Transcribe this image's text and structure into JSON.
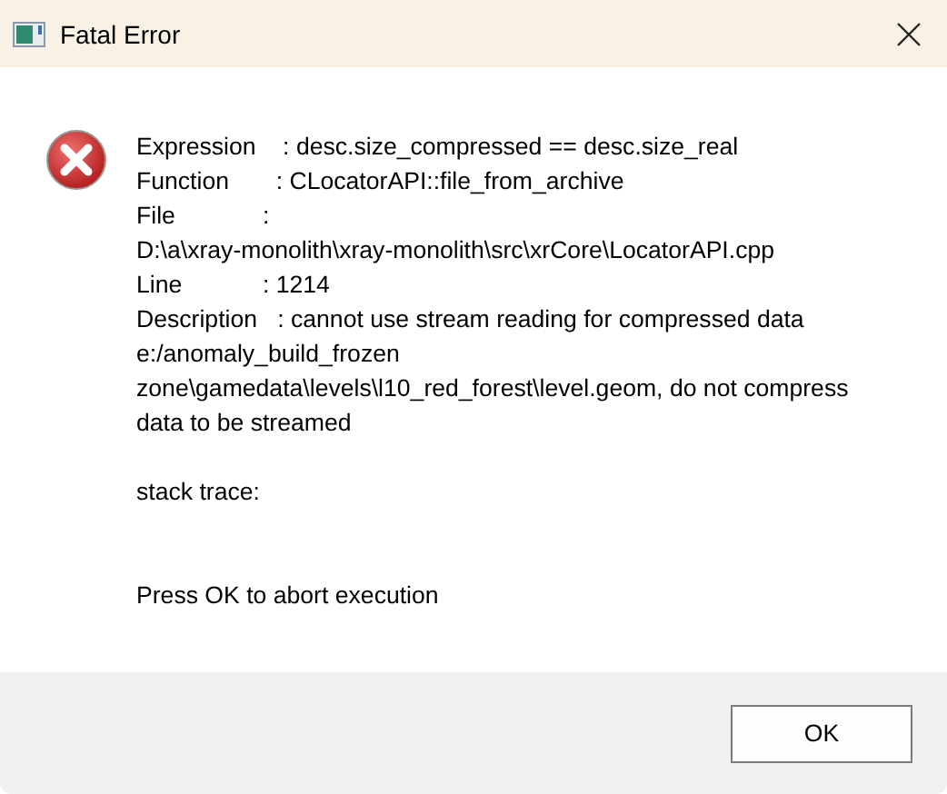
{
  "window": {
    "title": "Fatal Error"
  },
  "message": {
    "paragraphs": [
      [
        "Expression    : desc.size_compressed == desc.size_real",
        "Function       : CLocatorAPI::file_from_archive",
        "File             :",
        "D:\\a\\xray-monolith\\xray-monolith\\src\\xrCore\\LocatorAPI.cpp",
        "Line            : 1214",
        "Description   : cannot use stream reading for compressed data",
        "e:/anomaly_build_frozen",
        "zone\\gamedata\\levels\\l10_red_forest\\level.geom, do not compress",
        "data to be streamed"
      ],
      [
        "stack trace:"
      ],
      [
        "Press OK to abort execution"
      ]
    ]
  },
  "buttons": [
    "OK"
  ]
}
